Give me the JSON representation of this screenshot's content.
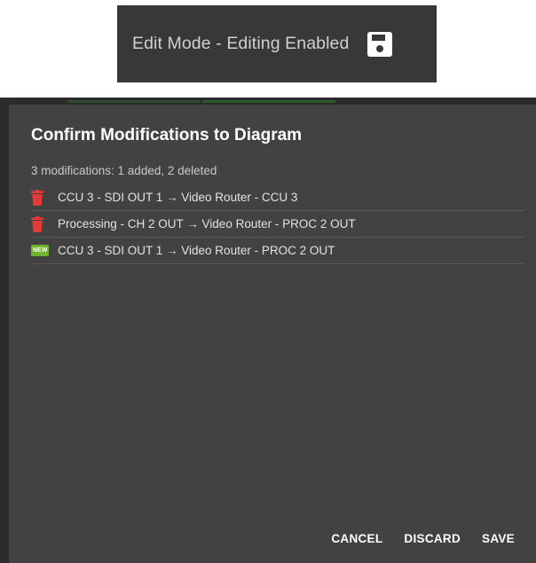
{
  "edit_mode": {
    "label": "Edit Mode - Editing Enabled",
    "icon": "save-icon"
  },
  "dialog": {
    "title": "Confirm Modifications to Diagram",
    "summary": "3 modifications: 1 added, 2 deleted",
    "modifications": [
      {
        "type": "deleted",
        "icon": "trash-icon",
        "label": "CCU 3 - SDI OUT 1 → Video Router - CCU 3"
      },
      {
        "type": "deleted",
        "icon": "trash-icon",
        "label": "Processing - CH 2 OUT → Video Router - PROC 2 OUT"
      },
      {
        "type": "added",
        "icon": "new-badge-icon",
        "badge": "NEW",
        "label": "CCU 3 - SDI OUT 1 → Video Router - PROC 2 OUT"
      }
    ],
    "actions": {
      "cancel": "CANCEL",
      "discard": "DISCARD",
      "save": "SAVE"
    }
  },
  "colors": {
    "dialog_bg": "#424242",
    "delete": "#e53935",
    "added": "#6fb52c",
    "pill_bg": "#383838"
  }
}
